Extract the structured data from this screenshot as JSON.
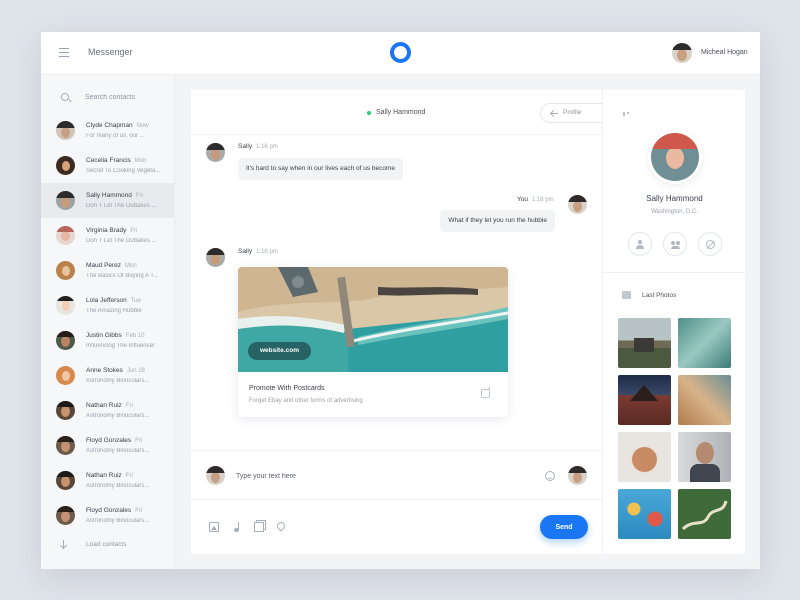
{
  "header": {
    "app_title": "Messenger",
    "user_name": "Micheal Hogan"
  },
  "search": {
    "placeholder": "Search contacts"
  },
  "contacts": [
    {
      "name": "Clyde Chapman",
      "time": "Now",
      "preview": "For many of us, our ..."
    },
    {
      "name": "Cecelia Francis",
      "time": "Mon",
      "preview": "Secret To Cooking Vegeta..."
    },
    {
      "name": "Sally Hammond",
      "time": "Fri",
      "preview": "Don T Let The Outtakes ..."
    },
    {
      "name": "Virginia Brady",
      "time": "Fri",
      "preview": "Don T Let The Outtakes ..."
    },
    {
      "name": "Maud Perez",
      "time": "Mon",
      "preview": "The Basics Of Buying A T..."
    },
    {
      "name": "Lola Jefferson",
      "time": "Tue",
      "preview": "The Amazing Hubble"
    },
    {
      "name": "Justin Gibbs",
      "time": "Feb 10",
      "preview": "Influencing The Influencer"
    },
    {
      "name": "Anne Stokes",
      "time": "Jun 28",
      "preview": "Astronomy Binoculars..."
    },
    {
      "name": "Nathan Ruiz",
      "time": "Fri",
      "preview": "Astronomy Binoculars..."
    },
    {
      "name": "Floyd Gonzales",
      "time": "Fri",
      "preview": "Astronomy Binoculars..."
    },
    {
      "name": "Nathan Ruiz",
      "time": "Fri",
      "preview": "Astronomy Binoculars..."
    },
    {
      "name": "Floyd Gonzales",
      "time": "Fri",
      "preview": "Astronomy Binoculars..."
    }
  ],
  "load_contacts_label": "Load contacts",
  "chat": {
    "contact_name": "Sally Hammond",
    "profile_label": "Profile",
    "messages": [
      {
        "sender": "Sally",
        "time": "1:16 pm",
        "text": "It's hard to say when in our lives each of us become"
      },
      {
        "sender": "You",
        "time": "1:16 pm",
        "text": "What if they let you run the hubble"
      },
      {
        "sender": "Sally",
        "time": "1:16 pm"
      }
    ],
    "link_card": {
      "url": "website.com",
      "title": "Promote With Postcards",
      "description": "Forget Ebay and other forms of advertising"
    },
    "input_placeholder": "Type your text here",
    "send_label": "Send"
  },
  "profile": {
    "name": "Sally Hammond",
    "location": "Washington, D.C.",
    "photos_title": "Last Photos"
  },
  "colors": {
    "accent": "#1a76f2",
    "online": "#2ecc71"
  }
}
